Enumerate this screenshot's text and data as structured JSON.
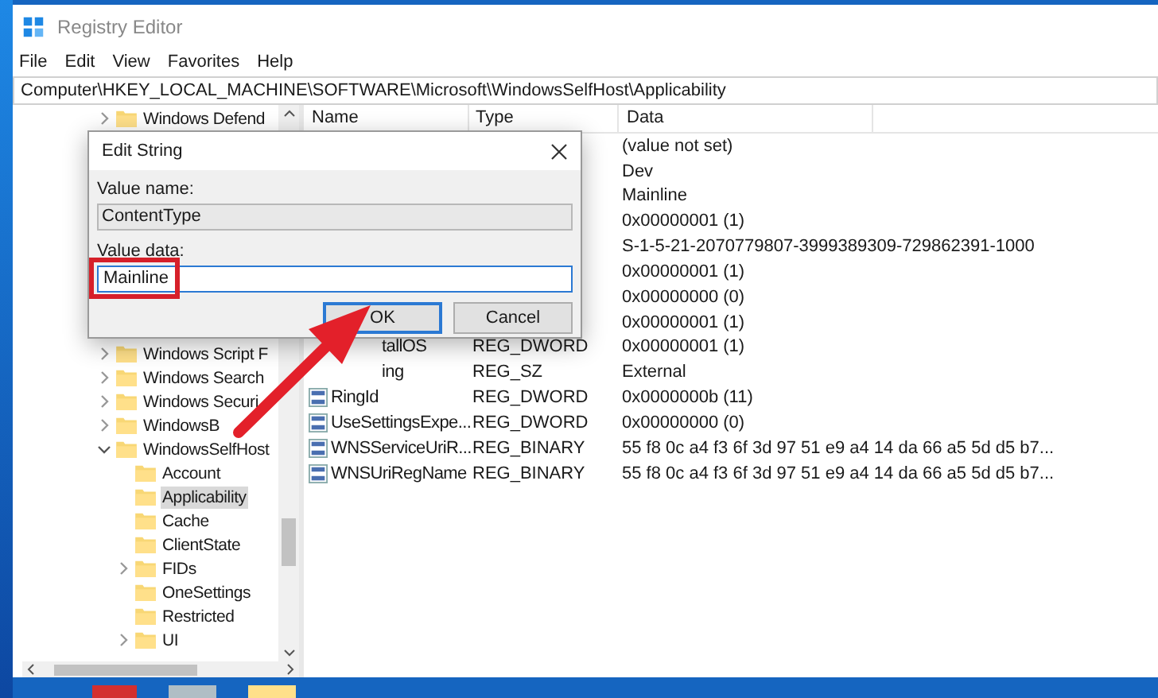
{
  "window": {
    "title": "Registry Editor"
  },
  "menu": [
    "File",
    "Edit",
    "View",
    "Favorites",
    "Help"
  ],
  "address": "Computer\\HKEY_LOCAL_MACHINE\\SOFTWARE\\Microsoft\\WindowsSelfHost\\Applicability",
  "tree_top": [
    {
      "label": "Windows Defend",
      "expanded": false,
      "selected": false
    }
  ],
  "tree": [
    {
      "label": "Windows Script F",
      "expanded": false,
      "selected": false
    },
    {
      "label": "Windows Search",
      "expanded": false,
      "selected": false
    },
    {
      "label": "Windows Securi",
      "expanded": false,
      "selected": false
    },
    {
      "label": "WindowsB",
      "expanded": false,
      "selected": false
    },
    {
      "label": "WindowsSelfHost",
      "expanded": true,
      "selected": false,
      "children": [
        {
          "label": "Account",
          "selected": false
        },
        {
          "label": "Applicability",
          "selected": true
        },
        {
          "label": "Cache",
          "selected": false
        },
        {
          "label": "ClientState",
          "selected": false
        },
        {
          "label": "FIDs",
          "expanded": false,
          "selected": false
        },
        {
          "label": "OneSettings",
          "selected": false
        },
        {
          "label": "Restricted",
          "selected": false
        },
        {
          "label": "UI",
          "expanded": false,
          "selected": false
        }
      ]
    }
  ],
  "columns": [
    "Name",
    "Type",
    "Data"
  ],
  "rows": [
    {
      "kind": "covered",
      "data": "(value not set)"
    },
    {
      "kind": "covered",
      "data": "Dev"
    },
    {
      "kind": "covered",
      "data": "Mainline"
    },
    {
      "kind": "covered",
      "data": "0x00000001 (1)"
    },
    {
      "kind": "covered",
      "data": "S-1-5-21-2070779807-3999389309-729862391-1000"
    },
    {
      "kind": "covered",
      "data": "0x00000001 (1)"
    },
    {
      "kind": "covered",
      "data": "0x00000000 (0)"
    },
    {
      "kind": "covered",
      "data": "0x00000001 (1)"
    },
    {
      "kind": "clipped",
      "name": "tallOS",
      "type": "REG_DWORD",
      "data": "0x00000001 (1)"
    },
    {
      "kind": "clipped",
      "name": "ing",
      "type": "REG_SZ",
      "data": "External"
    },
    {
      "kind": "binary",
      "name": "RingId",
      "type": "REG_DWORD",
      "data": "0x0000000b (11)"
    },
    {
      "kind": "binary",
      "name": "UseSettingsExpe...",
      "type": "REG_DWORD",
      "data": "0x00000000 (0)"
    },
    {
      "kind": "binary",
      "name": "WNSServiceUriR...",
      "type": "REG_BINARY",
      "data": "55 f8 0c a4 f3 6f 3d 97 51 e9 a4 14 da 66 a5 5d d5 b7..."
    },
    {
      "kind": "binary",
      "name": "WNSUriRegName",
      "type": "REG_BINARY",
      "data": "55 f8 0c a4 f3 6f 3d 97 51 e9 a4 14 da 66 a5 5d d5 b7..."
    }
  ],
  "dialog": {
    "title": "Edit String",
    "value_name_label": "Value name:",
    "value_name": "ContentType",
    "value_data_label": "Value data:",
    "value_data": "Mainline",
    "highlighted": true,
    "buttons": [
      {
        "label": "OK",
        "default": true
      },
      {
        "label": "Cancel",
        "default": false
      }
    ]
  }
}
